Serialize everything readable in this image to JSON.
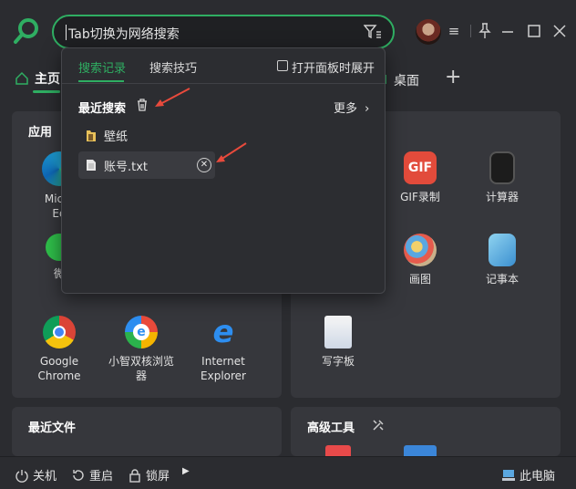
{
  "search": {
    "placeholder": "Tab切换为网络搜索",
    "filter_icon": "filter-icon"
  },
  "tabs": {
    "home": "主页",
    "desktop": "桌面",
    "add_icon": "plus-icon"
  },
  "panels": {
    "apps_title": "应用",
    "recent_files_title": "最近文件",
    "advanced_tools_title": "高级工具"
  },
  "apps": [
    {
      "label": "Micro\nEd",
      "icon": "edge-icon"
    },
    {
      "label": "GIF录制",
      "icon": "gif-icon"
    },
    {
      "label": "计算器",
      "icon": "calculator-icon"
    },
    {
      "label": "微",
      "icon": "wechat-icon"
    },
    {
      "label": "画图",
      "icon": "paint-icon"
    },
    {
      "label": "记事本",
      "icon": "notepad-icon"
    },
    {
      "label": "写字板",
      "icon": "wordpad-icon"
    },
    {
      "label": "Google Chrome",
      "icon": "chrome-icon"
    },
    {
      "label": "小智双核浏览器",
      "icon": "browser-icon"
    },
    {
      "label": "Internet Explorer",
      "icon": "ie-icon"
    }
  ],
  "popup": {
    "tab_history": "搜索记录",
    "tab_tips": "搜索技巧",
    "checkbox_label": "打开面板时展开",
    "recent_title": "最近搜索",
    "more": "更多",
    "items": [
      {
        "label": "壁纸",
        "icon": "folder-icon"
      },
      {
        "label": "账号.txt",
        "icon": "file-icon"
      }
    ]
  },
  "bottom": {
    "shutdown": "关机",
    "restart": "重启",
    "lock": "锁屏",
    "this_pc": "此电脑"
  },
  "colors": {
    "accent": "#2fae62",
    "background": "#2b2c30",
    "annotation_arrow": "#e84a3c"
  }
}
